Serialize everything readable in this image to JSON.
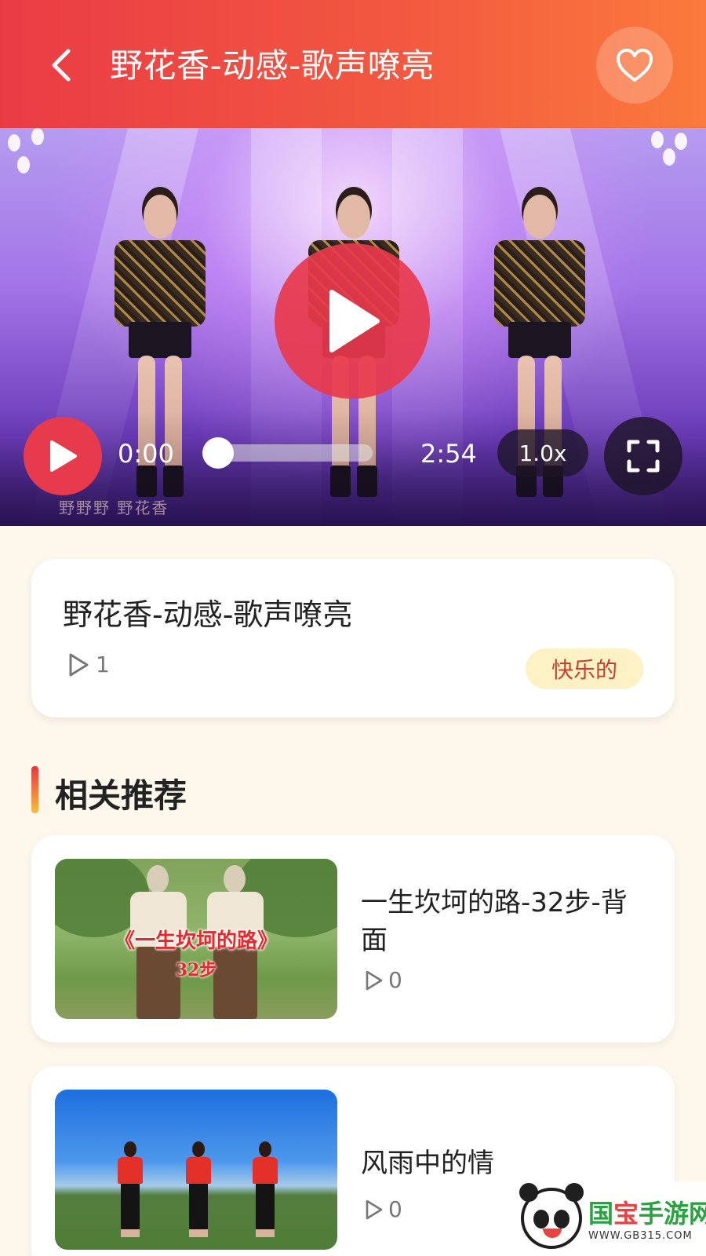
{
  "header": {
    "title": "野花香-动感-歌声嘹亮",
    "background_gradient": [
      "#ea3b45",
      "#fb7a3c"
    ]
  },
  "video": {
    "watermark_text": "野野野  野花香",
    "current_time": "0:00",
    "total_time": "2:54",
    "progress": 0.0,
    "speed": "1.0x",
    "accent_color": "#e73a4d"
  },
  "info": {
    "title": "野花香-动感-歌声嘹亮",
    "play_count": "1",
    "mood_tag": "快乐的"
  },
  "section": {
    "title": "相关推荐"
  },
  "recommendations": [
    {
      "title": "一生坎坷的路-32步-背面",
      "play_count": "0",
      "thumb_text": "《一生坎坷的路》",
      "thumb_subtext": "32步"
    },
    {
      "title": "风雨中的情",
      "play_count": "0"
    }
  ],
  "watermark": {
    "name_part1": "国",
    "name_part2": "宝",
    "name_part3": "手游网",
    "url": "WWW.GB315.COM"
  },
  "icons": [
    "back-arrow-icon",
    "heart-icon",
    "play-icon",
    "fullscreen-icon",
    "play-count-icon"
  ]
}
